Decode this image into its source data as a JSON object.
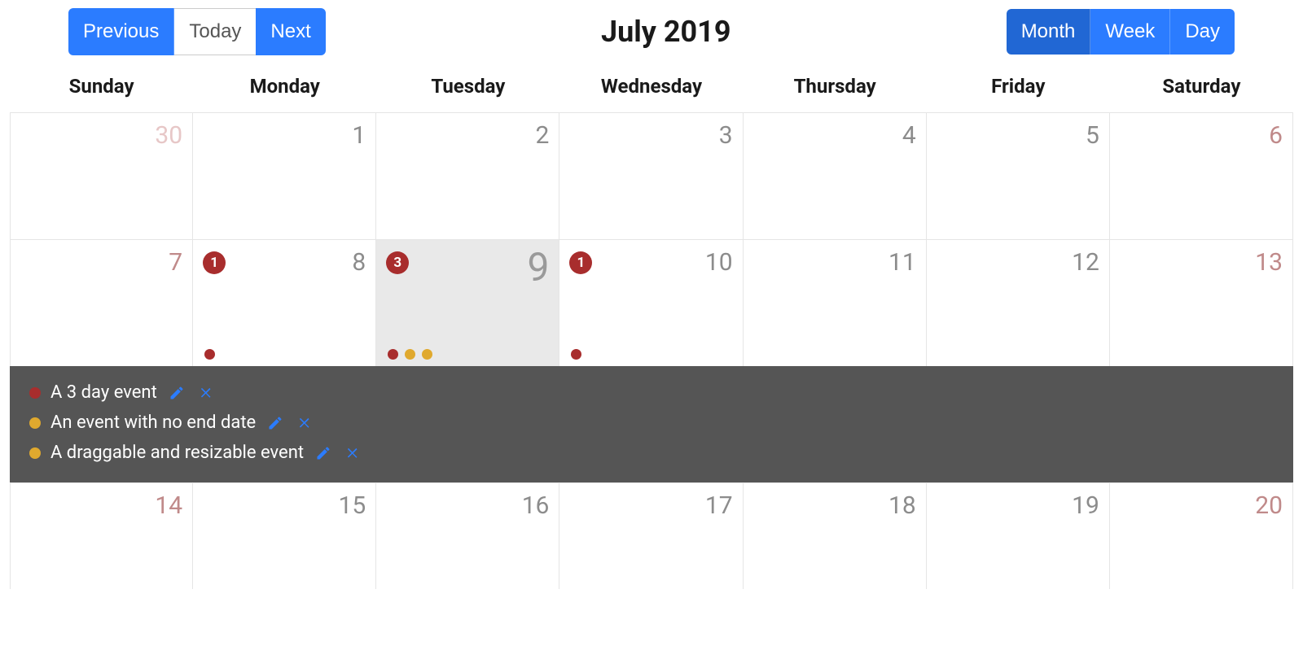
{
  "toolbar": {
    "prev_label": "Previous",
    "today_label": "Today",
    "next_label": "Next",
    "title": "July 2019",
    "views": {
      "month": "Month",
      "week": "Week",
      "day": "Day"
    }
  },
  "weekdays": [
    "Sunday",
    "Monday",
    "Tuesday",
    "Wednesday",
    "Thursday",
    "Friday",
    "Saturday"
  ],
  "colors": {
    "primary": "#2b7cff",
    "badge": "#a82d2d",
    "event_red": "#a82d2d",
    "event_yellow": "#e0a92e"
  },
  "rows": [
    {
      "cells": [
        {
          "day": "30",
          "style": "prev"
        },
        {
          "day": "1"
        },
        {
          "day": "2"
        },
        {
          "day": "3"
        },
        {
          "day": "4"
        },
        {
          "day": "5"
        },
        {
          "day": "6",
          "style": "weekend"
        }
      ]
    },
    {
      "cells": [
        {
          "day": "7",
          "style": "weekend"
        },
        {
          "day": "8",
          "badge": "1",
          "dots": [
            "red"
          ]
        },
        {
          "day": "9",
          "badge": "3",
          "dots": [
            "red",
            "yellow",
            "yellow"
          ],
          "open": true
        },
        {
          "day": "10",
          "badge": "1",
          "dots": [
            "red"
          ]
        },
        {
          "day": "11"
        },
        {
          "day": "12"
        },
        {
          "day": "13",
          "style": "weekend"
        }
      ]
    },
    {
      "cells": [
        {
          "day": "14",
          "style": "weekend"
        },
        {
          "day": "15"
        },
        {
          "day": "16"
        },
        {
          "day": "17"
        },
        {
          "day": "18"
        },
        {
          "day": "19"
        },
        {
          "day": "20",
          "style": "weekend"
        }
      ]
    }
  ],
  "open_events": [
    {
      "color": "red",
      "title": "A 3 day event"
    },
    {
      "color": "yellow",
      "title": "An event with no end date"
    },
    {
      "color": "yellow",
      "title": "A draggable and resizable event"
    }
  ]
}
